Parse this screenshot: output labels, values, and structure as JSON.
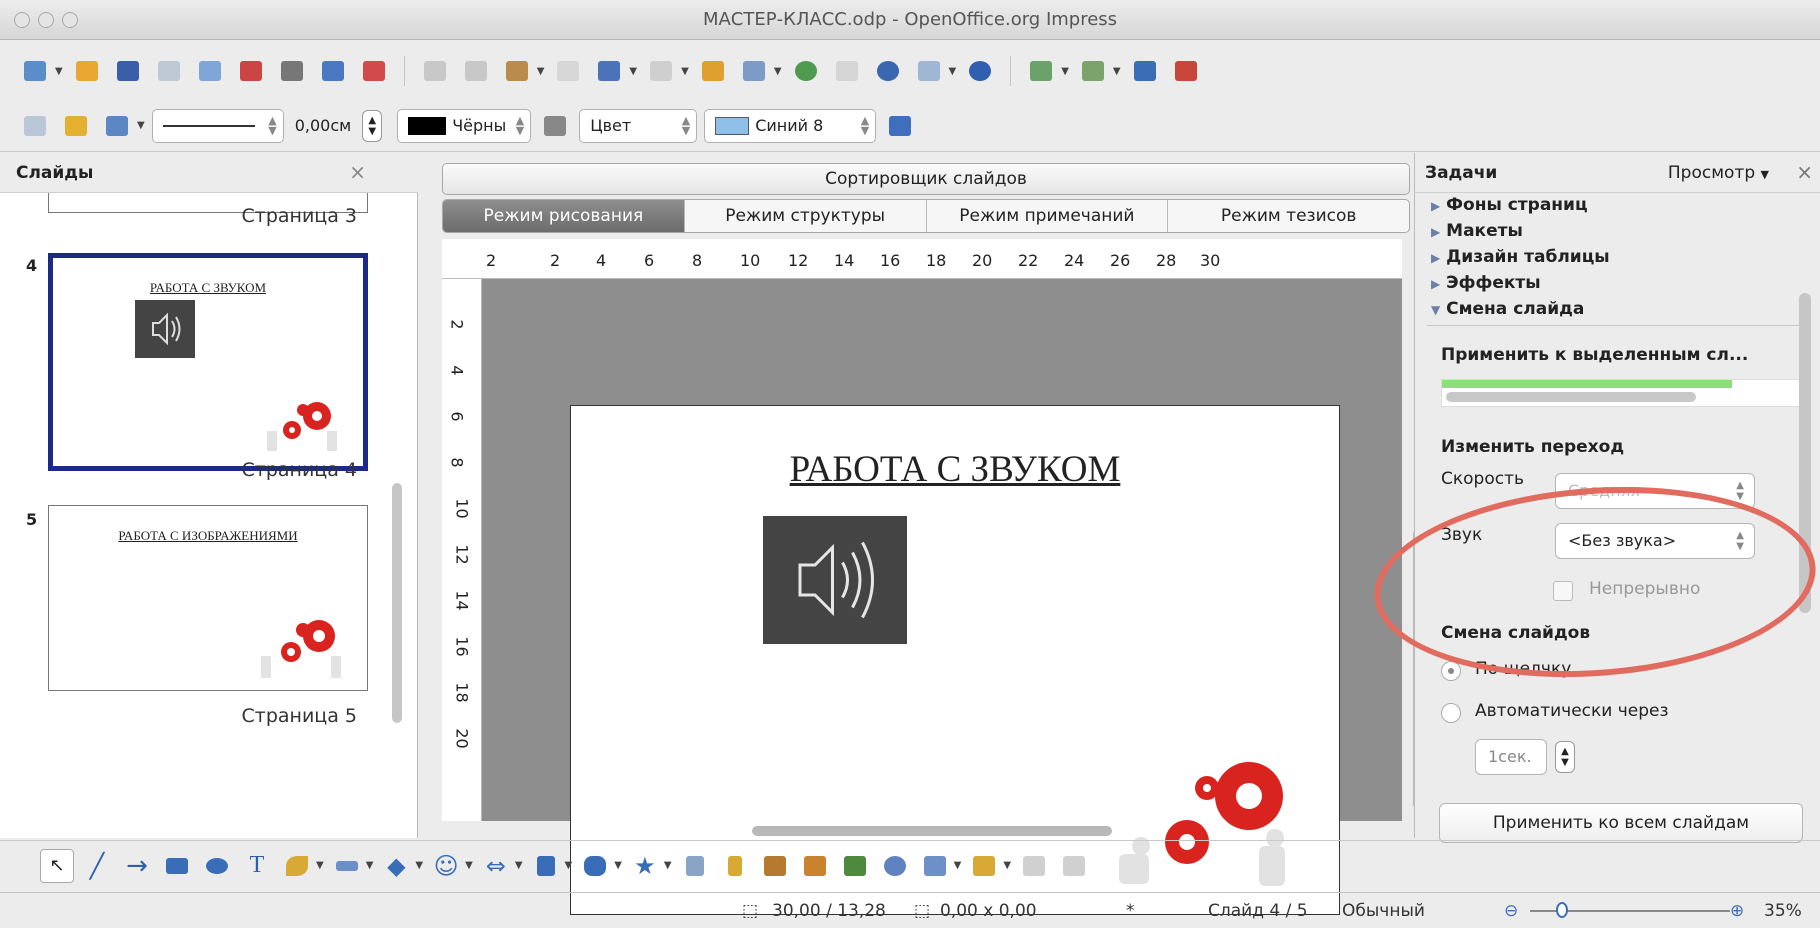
{
  "window": {
    "title": "МАСТЕР-КЛАСС.odp - OpenOffice.org Impress"
  },
  "toolbar2": {
    "line_width": "0,00см",
    "line_color": "Чёрны",
    "area_style": "Цвет",
    "area_color": "Синий 8"
  },
  "slides_panel": {
    "title": "Слайды",
    "close": "×",
    "items": [
      {
        "number": "",
        "label": "Страница 3",
        "title": ""
      },
      {
        "number": "4",
        "label": "Страница 4",
        "title": "РАБОТА С ЗВУКОМ"
      },
      {
        "number": "5",
        "label": "Страница 5",
        "title": "РАБОТА С ИЗОБРАЖЕНИЯМИ"
      }
    ]
  },
  "editor": {
    "sorter_label": "Сортировщик слайдов",
    "tabs": [
      "Режим рисования",
      "Режим структуры",
      "Режим примечаний",
      "Режим тезисов"
    ],
    "hruler_ticks": [
      "2",
      "2",
      "4",
      "6",
      "8",
      "10",
      "12",
      "14",
      "16",
      "18",
      "20",
      "22",
      "24",
      "26",
      "28",
      "30"
    ],
    "vruler_ticks": [
      "2",
      "4",
      "6",
      "8",
      "10",
      "12",
      "14",
      "16",
      "18",
      "20"
    ],
    "slide_title": "РАБОТА С ЗВУКОМ"
  },
  "tasks": {
    "title": "Задачи",
    "view_menu": "Просмотр",
    "close": "×",
    "categories": [
      "Фоны страниц",
      "Макеты",
      "Дизайн таблицы",
      "Эффекты",
      "Смена слайда"
    ],
    "apply_selected": "Применить к выделенным сл...",
    "change_transition": "Изменить переход",
    "speed_label": "Скорость",
    "speed_value": "Средняя",
    "sound_label": "Звук",
    "sound_value": "<Без звука>",
    "loop_label": "Непрерывно",
    "advance_header": "Смена слайдов",
    "on_click": "По щелчку",
    "auto_after": "Автоматически через",
    "seconds": "1сек.",
    "apply_all": "Применить ко всем слайдам"
  },
  "status": {
    "position": "30,00 / 13,28",
    "size": "0,00 x 0,00",
    "modified": "*",
    "slide": "Слайд 4 / 5",
    "layout": "Обычный",
    "zoom": "35%"
  }
}
